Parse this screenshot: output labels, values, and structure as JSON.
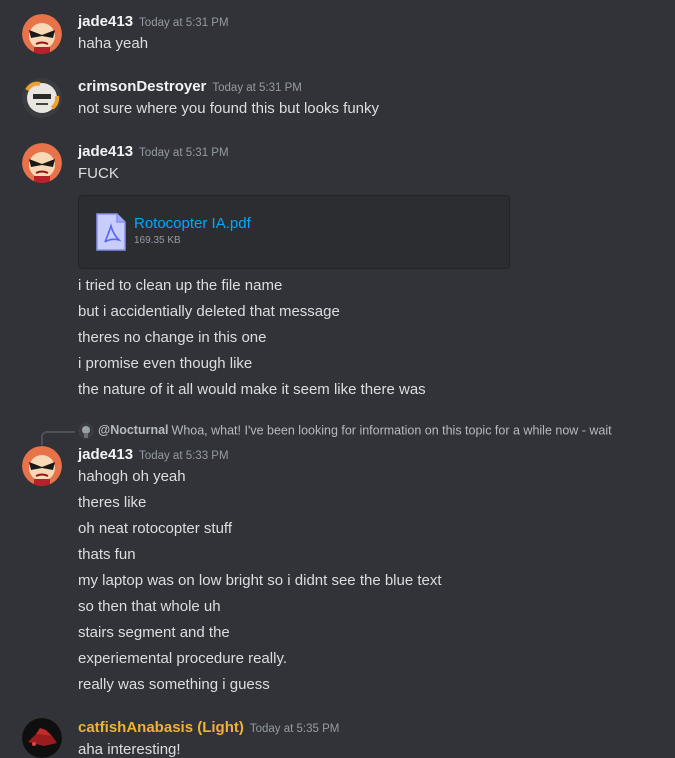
{
  "messages": [
    {
      "username": "jade413",
      "timestamp": "Today at 5:31 PM",
      "lines": [
        "haha yeah"
      ]
    },
    {
      "username": "crimsonDestroyer",
      "timestamp": "Today at 5:31 PM",
      "lines": [
        "not sure where you found this but looks funky"
      ]
    },
    {
      "username": "jade413",
      "timestamp": "Today at 5:31 PM",
      "lines": [
        "FUCK"
      ],
      "attachment": {
        "file_name": "Rotocopter IA.pdf",
        "file_size": "169.35 KB",
        "icon": "pdf-file-icon"
      },
      "after_lines": [
        "i tried to clean up the file name",
        "but i accidentially deleted that message",
        "theres no change in this one",
        "i promise even though like",
        "the nature of it all would make it seem like there was"
      ]
    },
    {
      "reply_to": {
        "name": "@Nocturnal",
        "text": "Whoa, what! I've been looking for information on this topic for a while now - wait"
      },
      "username": "jade413",
      "timestamp": "Today at 5:33 PM",
      "lines": [
        "hahogh oh yeah",
        "theres like",
        "oh neat rotocopter stuff",
        "thats fun",
        "my laptop was on low bright so i didnt see the blue text",
        "so then that whole uh",
        "stairs segment and the",
        "experiemental procedure really.",
        "really was something i guess"
      ]
    },
    {
      "username": "catfishAnabasis (Light)",
      "username_color": "#f0b232",
      "timestamp": "Today at 5:35 PM",
      "lines": [
        "aha interesting!"
      ]
    }
  ]
}
